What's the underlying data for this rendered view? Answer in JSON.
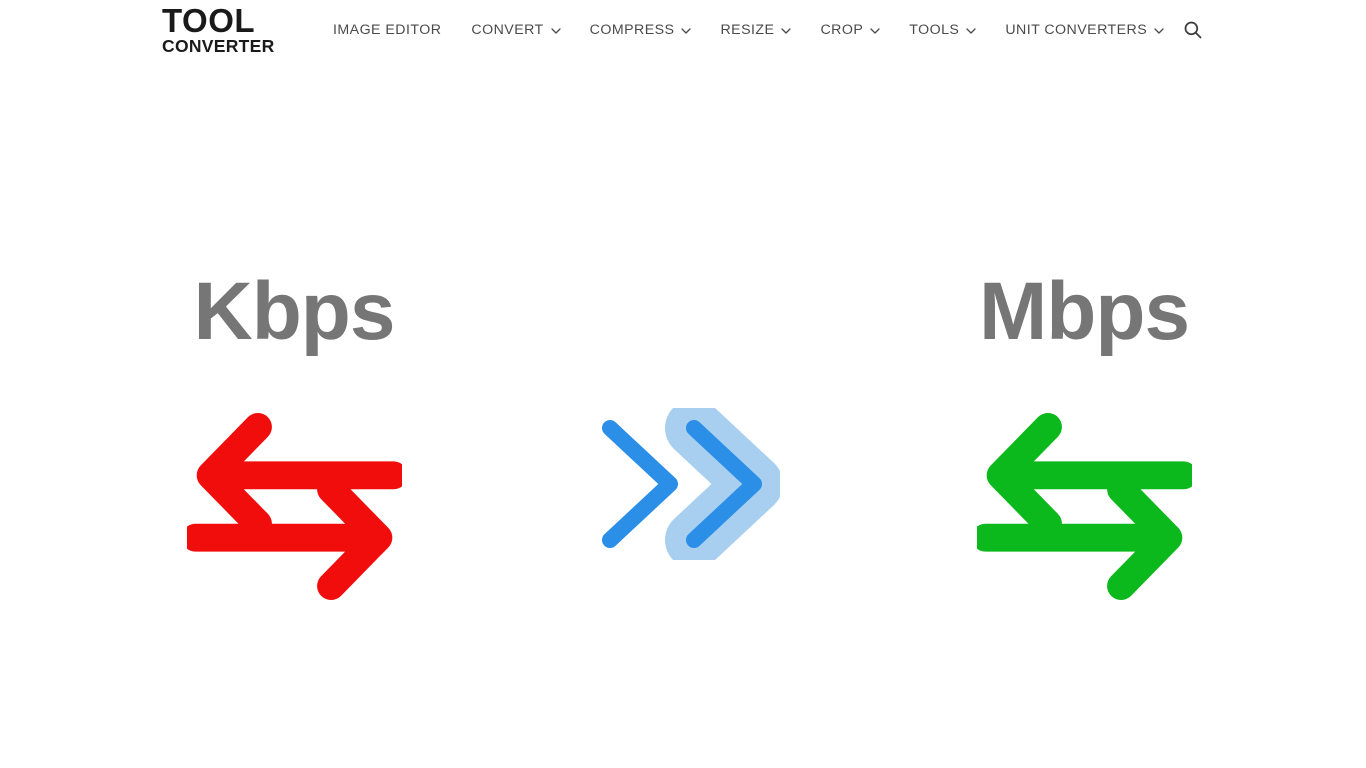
{
  "page": {
    "background": "#ffffff"
  },
  "header": {
    "logo": {
      "line1": "TOOL",
      "line2": "CONVERTER",
      "color": "#1a1a1a"
    },
    "nav_text_color": "#4a4a4a",
    "nav": [
      {
        "label": "IMAGE EDITOR",
        "has_dropdown": false
      },
      {
        "label": "CONVERT",
        "has_dropdown": true
      },
      {
        "label": "COMPRESS",
        "has_dropdown": true
      },
      {
        "label": "RESIZE",
        "has_dropdown": true
      },
      {
        "label": "CROP",
        "has_dropdown": true
      },
      {
        "label": "TOOLS",
        "has_dropdown": true
      },
      {
        "label": "UNIT CONVERTERS",
        "has_dropdown": true
      }
    ],
    "search": {
      "icon": "search-icon",
      "label": "Search"
    }
  },
  "main": {
    "from_unit": {
      "label": "Kbps",
      "label_color": "#767676",
      "icon": "exchange-arrows-icon",
      "icon_color": "#f20d0d"
    },
    "separator": {
      "icon": "double-chevron-right-icon",
      "stroke_color": "#2b8fe8",
      "fill_color": "#a8cff0"
    },
    "to_unit": {
      "label": "Mbps",
      "label_color": "#767676",
      "icon": "exchange-arrows-icon",
      "icon_color": "#0cb91d"
    }
  }
}
